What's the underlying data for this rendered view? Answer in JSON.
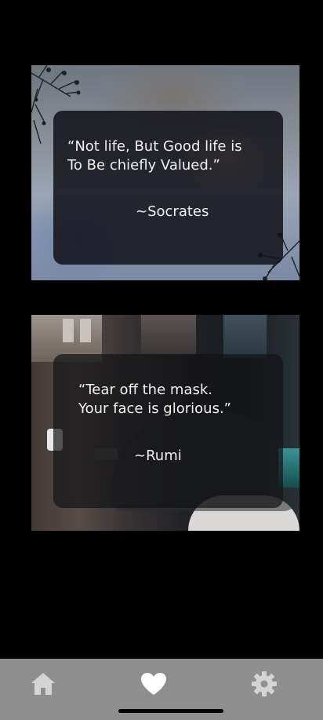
{
  "cards": [
    {
      "quote": "“Not life, But Good life is\nTo Be chiefly Valued.”",
      "author": "~Socrates"
    },
    {
      "quote": "“Tear off the mask.\nYour face is glorious.”",
      "author": "~Rumi"
    }
  ],
  "nav": {
    "items": [
      {
        "icon": "home-icon"
      },
      {
        "icon": "heart-icon",
        "selected": true
      },
      {
        "icon": "gear-icon"
      }
    ],
    "background": "#8e8e8e",
    "selected_color": "#ffffff",
    "icon_color": "#d0d0d0"
  }
}
